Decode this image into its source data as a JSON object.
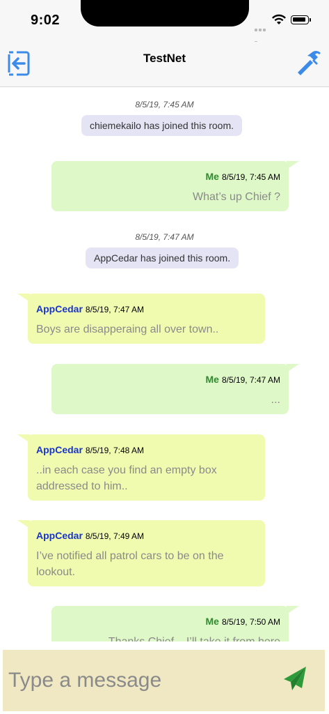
{
  "status_bar": {
    "time": "9:02"
  },
  "nav": {
    "title": "TestNet"
  },
  "system_messages": [
    {
      "time": "8/5/19, 7:45 AM",
      "text": "chiemekailo has joined this room."
    },
    {
      "time": "8/5/19, 7:47 AM",
      "text": "AppCedar has joined this room."
    }
  ],
  "messages": [
    {
      "sender": "Me",
      "time": "8/5/19, 7:45 AM",
      "text": "What’s up Chief ?"
    },
    {
      "sender": "AppCedar",
      "time": "8/5/19, 7:47 AM",
      "text": "Boys are disapperaing all over town.."
    },
    {
      "sender": "Me",
      "time": "8/5/19, 7:47 AM",
      "text": "..."
    },
    {
      "sender": "AppCedar",
      "time": "8/5/19, 7:48 AM",
      "text": "..in each case you find an empty box addressed to him.."
    },
    {
      "sender": "AppCedar",
      "time": "8/5/19, 7:49 AM",
      "text": "I’ve notified all patrol cars to be on the lookout."
    },
    {
      "sender": "Me",
      "time": "8/5/19, 7:50 AM",
      "text": "Thanks Chief... I’ll take it from here"
    }
  ],
  "composer": {
    "placeholder": "Type a message"
  },
  "colors": {
    "me_bubble": "#def8c8",
    "other_bubble": "#f0fbb0",
    "system_pill": "#e4e4f5",
    "me_name": "#2e8b2e",
    "other_name": "#1a34c8",
    "accent": "#3d8be8",
    "send": "#2e9a3a",
    "composer_bg": "#efe8c2"
  },
  "icons": [
    "logout-icon",
    "hammer-icon",
    "send-icon",
    "wifi-icon",
    "battery-icon",
    "cellular-signal-icon"
  ]
}
